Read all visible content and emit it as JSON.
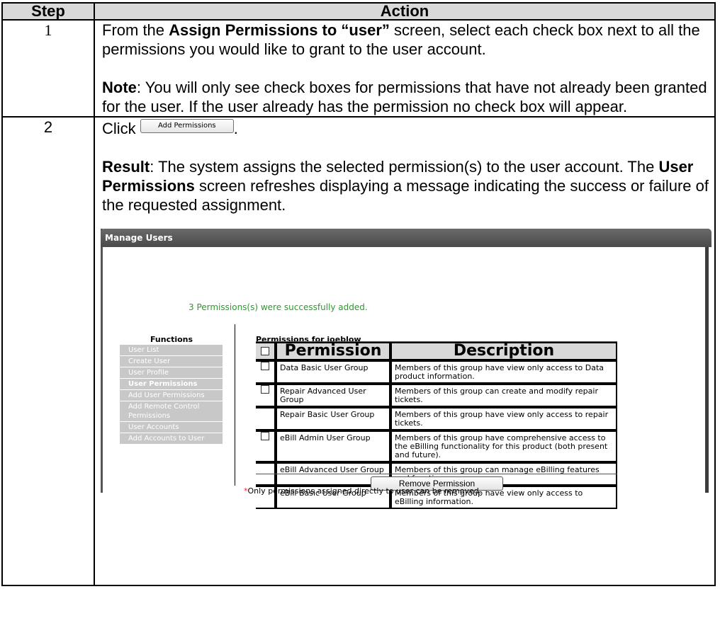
{
  "table": {
    "header_step": "Step",
    "header_action": "Action"
  },
  "row1": {
    "step": "1",
    "p1_pre": "From the ",
    "p1_bold": "Assign Permissions to “user”",
    "p1_post": " screen, select each check box next to all the permissions you would like to grant to the user account.",
    "note_label": "Note",
    "note_text": ":  You will only see check boxes for permissions that have not already been granted for the user.  If the user already has the permission no check box will appear."
  },
  "row2": {
    "step": "2",
    "click_text": "Click",
    "button_label": "Add Permissions",
    "period": ".",
    "result_label": "Result",
    "result_pre": ":  The system assigns the selected permission(s) to the user account.  The ",
    "result_bold": "User Permissions",
    "result_post": " screen refreshes displaying a message indicating the success or failure of the requested assignment."
  },
  "screen": {
    "header_title": "Manage Users",
    "success_message": "3 Permissions(s) were successfully added.",
    "functions_title": "Functions",
    "functions": [
      "User List",
      "Create User",
      "User Profile",
      "User Permissions",
      "Add User Permissions",
      "Add Remote Control Permissions",
      "User Accounts",
      "Add Accounts to User"
    ],
    "permissions_title": "Permissions for joeblow",
    "col_permission": "Permission",
    "col_description": "Description",
    "rows": [
      {
        "name": "Data Basic User Group",
        "desc": "Members of this group have view only access to Data product information.",
        "checkbox": true
      },
      {
        "name": "Repair Advanced User Group",
        "desc": "Members of this group can create and modify repair tickets.",
        "checkbox": true
      },
      {
        "name": "Repair Basic User Group",
        "desc": "Members of this group have view only access to repair tickets.",
        "checkbox": false
      },
      {
        "name": "eBill Admin User Group",
        "desc": "Members of this group have comprehensive access to the eBilling functionality for this product (both present and future).",
        "checkbox": true
      },
      {
        "name": "eBill Advanced User Group",
        "desc": "Members of this group can manage eBilling features and functions.",
        "checkbox": false
      },
      {
        "name": "eBill Basic User Group",
        "desc": "Members of this group have view only access to eBilling information.",
        "checkbox": false
      }
    ],
    "remove_button": "Remove Permission",
    "footnote_star": "*",
    "footnote_text": "Only permissions assigned directly to user can be removed."
  }
}
